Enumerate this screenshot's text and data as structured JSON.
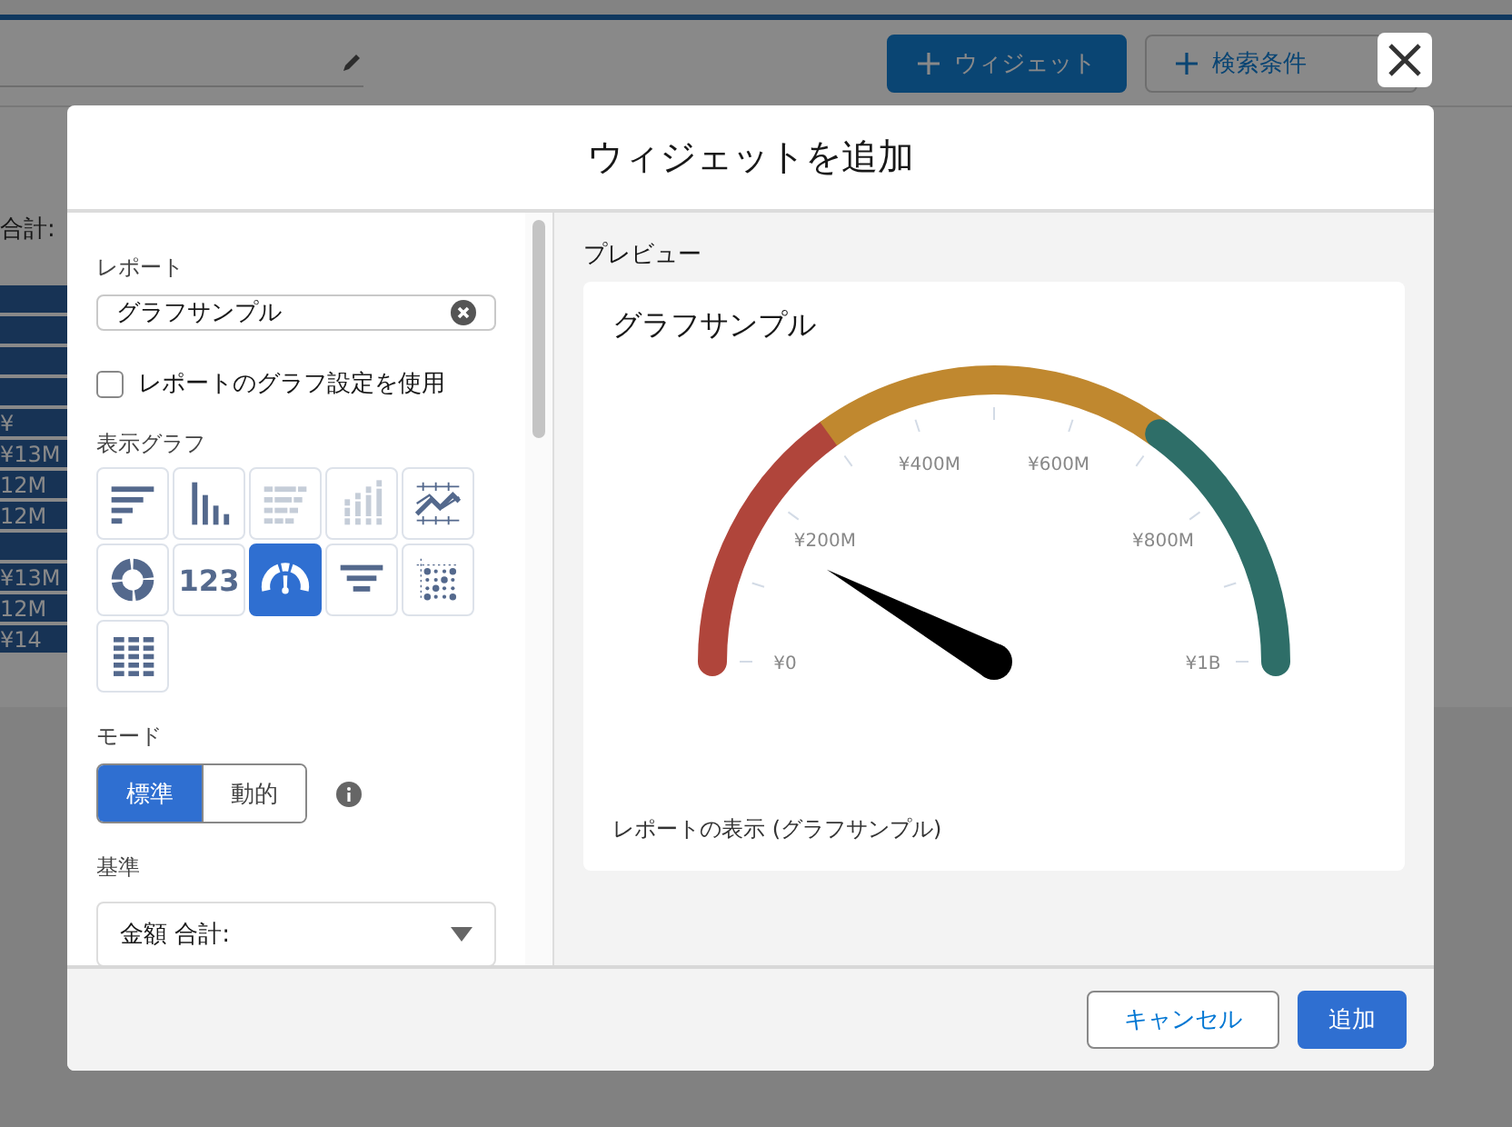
{
  "background": {
    "toolbar_buttons": [
      {
        "label": "ウィジェット",
        "kind": "brand"
      },
      {
        "label": "検索条件",
        "kind": "outline"
      }
    ],
    "summary_label": "合計:",
    "bars": [
      {
        "kind": "plain"
      },
      {
        "kind": "plain"
      },
      {
        "kind": "plain"
      },
      {
        "kind": "plain"
      },
      {
        "kind": "labeled",
        "label": "¥"
      },
      {
        "kind": "labeled",
        "label": "¥13M"
      },
      {
        "kind": "labeled",
        "label": "12M"
      },
      {
        "kind": "labeled",
        "label": "12M"
      },
      {
        "kind": "plain"
      },
      {
        "kind": "labeled",
        "label": "¥13M"
      },
      {
        "kind": "labeled",
        "label": "12M"
      },
      {
        "kind": "labeled",
        "label": "¥14"
      }
    ]
  },
  "modal": {
    "title": "ウィジェットを追加",
    "report": {
      "label": "レポート",
      "value": "グラフサンプル"
    },
    "use_report_chart": {
      "label": "レポートのグラフ設定を使用",
      "checked": false
    },
    "chart_types": {
      "label": "表示グラフ",
      "items": [
        {
          "kind": "bar-h",
          "selected": false,
          "disabled": false
        },
        {
          "kind": "bar-v",
          "selected": false,
          "disabled": false
        },
        {
          "kind": "stacked-h",
          "selected": false,
          "disabled": true
        },
        {
          "kind": "stacked-v",
          "selected": false,
          "disabled": true
        },
        {
          "kind": "line",
          "selected": false,
          "disabled": false
        },
        {
          "kind": "donut",
          "selected": false,
          "disabled": false
        },
        {
          "kind": "metric",
          "label": "123",
          "selected": false,
          "disabled": false
        },
        {
          "kind": "gauge",
          "selected": true,
          "disabled": false
        },
        {
          "kind": "funnel",
          "selected": false,
          "disabled": false
        },
        {
          "kind": "scatter",
          "selected": false,
          "disabled": false
        },
        {
          "kind": "table",
          "selected": false,
          "disabled": false
        }
      ]
    },
    "mode": {
      "label": "モード",
      "options": [
        {
          "label": "標準",
          "selected": true
        },
        {
          "label": "動的",
          "selected": false
        }
      ]
    },
    "measure": {
      "label": "基準",
      "value": "金額 合計:"
    },
    "preview": {
      "label": "プレビュー",
      "title": "グラフサンプル",
      "gauge": {
        "level": 0.16,
        "tick_labels": [
          "¥0",
          "¥200M",
          "¥400M",
          "¥600M",
          "¥800M",
          "¥1B"
        ],
        "bands": [
          {
            "color": "#b0453b"
          },
          {
            "color": "#c0882f"
          },
          {
            "color": "#2e6e68"
          }
        ]
      },
      "link": "レポートの表示 (グラフサンプル)"
    },
    "buttons": [
      {
        "label": "キャンセル",
        "kind": "neutral"
      },
      {
        "label": "追加",
        "kind": "brand"
      }
    ]
  }
}
